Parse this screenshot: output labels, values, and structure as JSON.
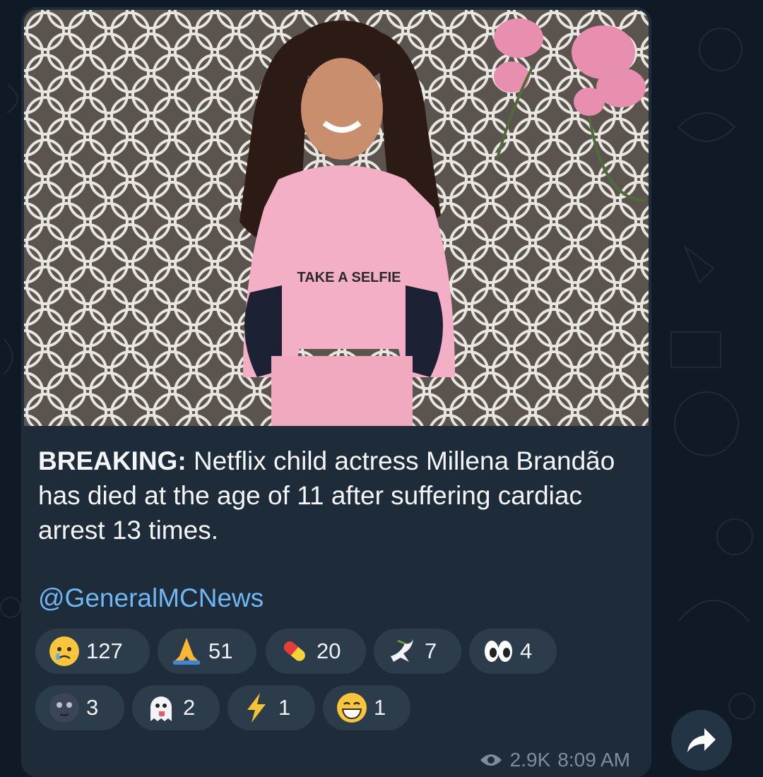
{
  "post": {
    "caption_bold": "BREAKING:",
    "caption_text": " Netflix child actress Millena Brandão has died at the age of 11 after suffering cardiac arrest 13 times.",
    "handle": "@GeneralMCNews",
    "hoodie_text": "TAKE A SELFIE",
    "views": "2.9K",
    "time": "8:09 AM"
  },
  "reactions": [
    {
      "icon": "crying-face",
      "count": "127"
    },
    {
      "icon": "folded-hands",
      "count": "51"
    },
    {
      "icon": "pill",
      "count": "20"
    },
    {
      "icon": "dove",
      "count": "7"
    },
    {
      "icon": "eyes",
      "count": "4"
    },
    {
      "icon": "new-moon-face",
      "count": "3"
    },
    {
      "icon": "ghost",
      "count": "2"
    },
    {
      "icon": "high-voltage",
      "count": "1"
    },
    {
      "icon": "grinning-face",
      "count": "1"
    }
  ],
  "colors": {
    "background": "#0f1a26",
    "bubble": "#1e2c3a",
    "link": "#6fb7f4",
    "reaction_bg": "#2d3c4b"
  }
}
